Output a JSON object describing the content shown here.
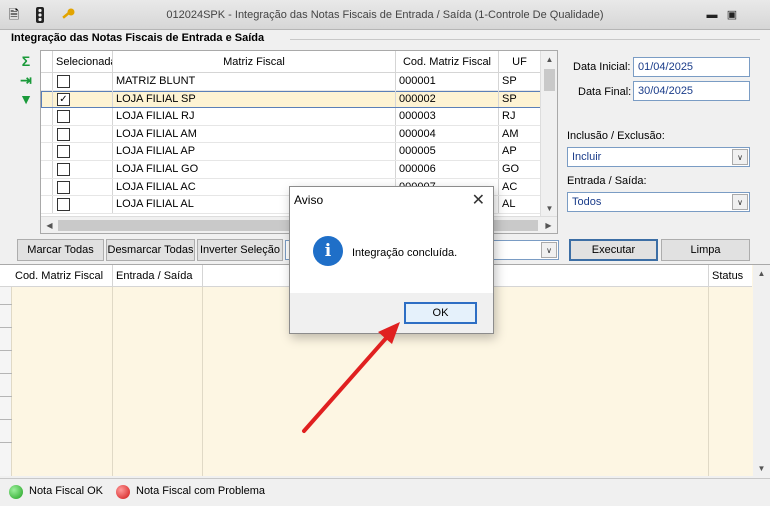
{
  "window": {
    "title": "012024SPK - Integração das Notas Fiscais de Entrada / Saída (1-Controle De Qualidade)",
    "icons": [
      "report-icon",
      "traffic-light-icon",
      "key-icon"
    ],
    "controls": [
      "restore-icon",
      "maximize-icon"
    ]
  },
  "section": {
    "title": "Integração das Notas Fiscais de Entrada e Saída"
  },
  "side_tools": [
    "sigma-icon",
    "export-icon",
    "filter-icon"
  ],
  "table": {
    "columns": [
      "Selecionada",
      "Matriz Fiscal",
      "Cod. Matriz Fiscal",
      "UF"
    ],
    "rows": [
      {
        "checked": false,
        "matriz": "MATRIZ BLUNT",
        "cod": "000001",
        "uf": "SP"
      },
      {
        "checked": true,
        "matriz": "LOJA FILIAL SP",
        "cod": "000002",
        "uf": "SP"
      },
      {
        "checked": false,
        "matriz": "LOJA FILIAL RJ",
        "cod": "000003",
        "uf": "RJ"
      },
      {
        "checked": false,
        "matriz": "LOJA FILIAL AM",
        "cod": "000004",
        "uf": "AM"
      },
      {
        "checked": false,
        "matriz": "LOJA FILIAL AP",
        "cod": "000005",
        "uf": "AP"
      },
      {
        "checked": false,
        "matriz": "LOJA FILIAL GO",
        "cod": "000006",
        "uf": "GO"
      },
      {
        "checked": false,
        "matriz": "LOJA FILIAL AC",
        "cod": "000007",
        "uf": "AC"
      },
      {
        "checked": false,
        "matriz": "LOJA FILIAL AL",
        "cod": "000008",
        "uf": "AL"
      }
    ]
  },
  "filters": {
    "data_inicial_label": "Data Inicial:",
    "data_inicial": "01/04/2025",
    "data_final_label": "Data Final:",
    "data_final": "30/04/2025",
    "inclusao_label": "Inclusão / Exclusão:",
    "inclusao_value": "Incluir",
    "entrada_label": "Entrada / Saída:",
    "entrada_value": "Todos"
  },
  "buttons": {
    "marcar": "Marcar Todas",
    "desmarcar": "Desmarcar Todas",
    "inverter": "Inverter Seleção",
    "executar": "Executar",
    "limpa": "Limpa"
  },
  "results": {
    "columns": [
      "Cod. Matriz Fiscal",
      "Entrada / Saída",
      "Status"
    ]
  },
  "legend": {
    "ok": "Nota Fiscal OK",
    "problem": "Nota Fiscal com Problema",
    "ok_color": "#1fa01f",
    "problem_color": "#d01515"
  },
  "dialog": {
    "title": "Aviso",
    "message": "Integração concluída.",
    "ok": "OK",
    "icon": "info-icon"
  },
  "annotation": {
    "color": "#e02020"
  }
}
